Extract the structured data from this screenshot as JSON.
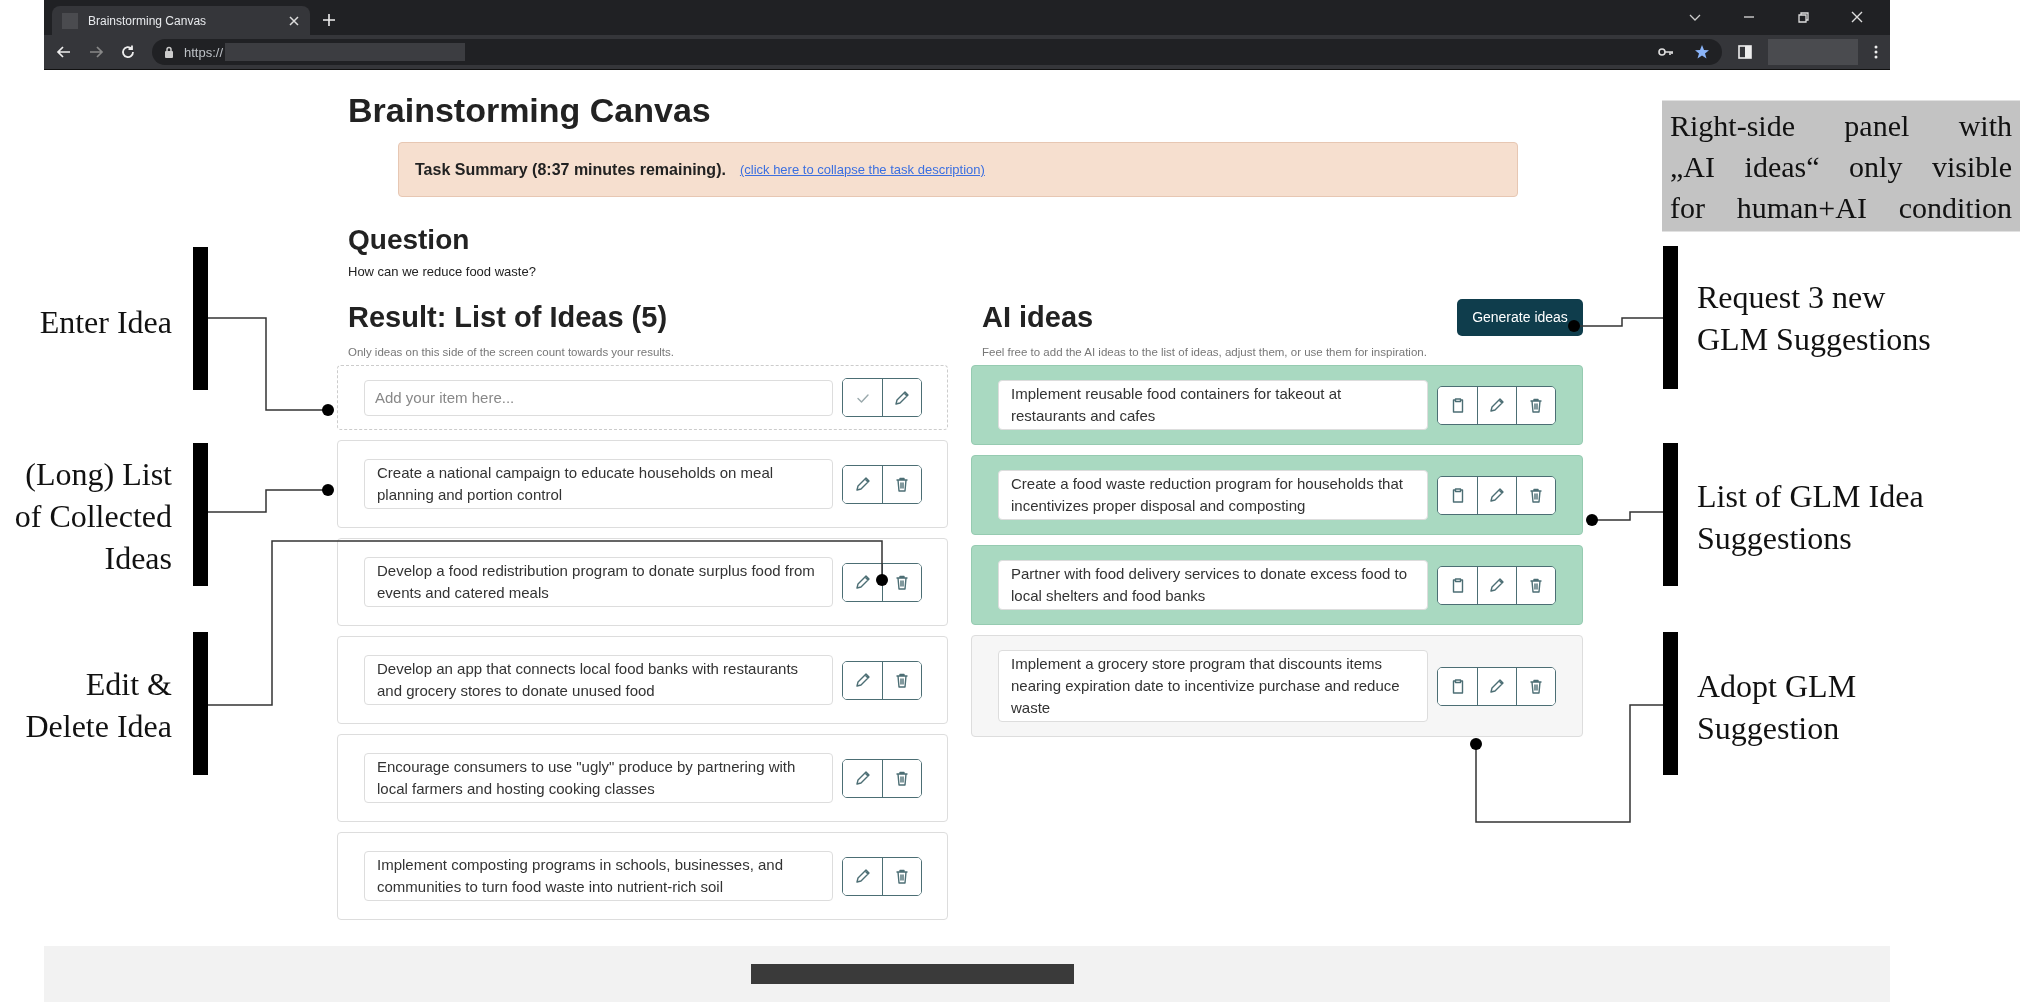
{
  "browser": {
    "tab_title": "Brainstorming Canvas",
    "url": "https://"
  },
  "page": {
    "title": "Brainstorming Canvas",
    "task_summary": {
      "text": "Task Summary (8:37 minutes remaining).",
      "link": "(click here to collapse the task description)"
    },
    "question": {
      "heading": "Question",
      "text": "How can we reduce food waste?"
    },
    "ideas": {
      "heading": "Result: List of Ideas (5)",
      "hint": "Only ideas on this side of the screen count towards your results.",
      "input": {
        "placeholder": "Add your item here..."
      },
      "items": [
        {
          "text": "Create a national campaign to educate households on meal planning and portion control"
        },
        {
          "text": "Develop a food redistribution program to donate surplus food from events and catered meals"
        },
        {
          "text": "Develop an app that connects local food banks with restaurants and grocery stores to donate unused food"
        },
        {
          "text": "Encourage consumers to use \"ugly\" produce by partnering with local farmers and hosting cooking classes"
        },
        {
          "text": "Implement composting programs in schools, businesses, and communities to turn food waste into nutrient-rich soil"
        }
      ]
    },
    "ai_ideas": {
      "heading": "AI ideas",
      "button": "Generate ideas",
      "hint": "Feel free to add the AI ideas to the list of ideas, adjust them, or use them for inspiration.",
      "items": [
        {
          "text": "Implement reusable food containers for takeout at restaurants and cafes",
          "highlighted": true
        },
        {
          "text": "Create a food waste reduction program for households that incentivizes proper disposal and composting",
          "highlighted": true
        },
        {
          "text": "Partner with food delivery services to donate excess food to local shelters and food banks",
          "highlighted": true
        },
        {
          "text": "Implement a grocery store program that discounts items nearing expiration date to incentivize purchase and reduce waste",
          "highlighted": false
        }
      ]
    }
  },
  "annotations": [
    {
      "kind": "note",
      "text": "Right-side panel with\n„AI ideas“ only visible\nfor human+AI condition"
    },
    {
      "kind": "left",
      "text": "Enter Idea"
    },
    {
      "kind": "left",
      "text": "(Long) List of Collected Ideas"
    },
    {
      "kind": "left",
      "text": "Edit & Delete Idea"
    },
    {
      "kind": "right",
      "text": "Request 3 new GLM Suggestions"
    },
    {
      "kind": "right",
      "text": "List of GLM Idea Suggestions"
    },
    {
      "kind": "right",
      "text": "Adopt GLM Suggestion"
    }
  ]
}
